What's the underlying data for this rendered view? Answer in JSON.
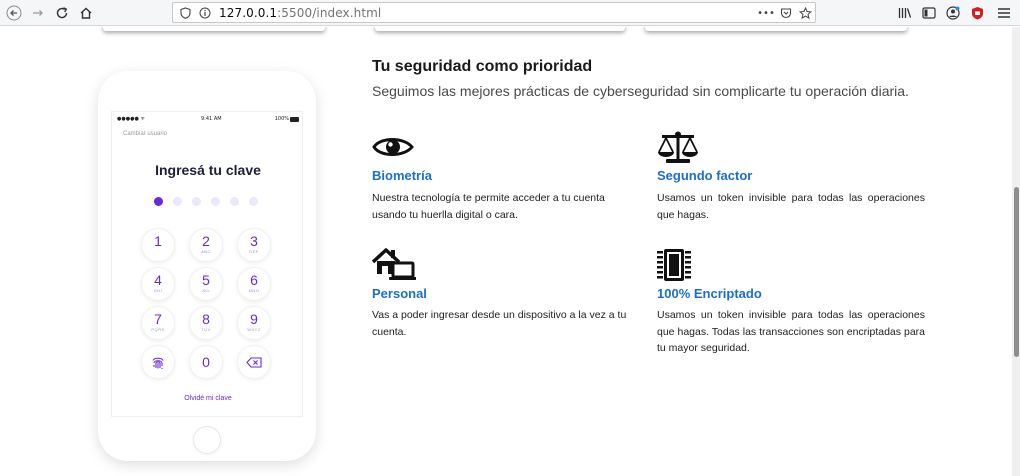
{
  "browser": {
    "url_host": "127.0.0.1",
    "url_rest": ":5500/index.html",
    "icons": {
      "back": "back-arrow-icon",
      "forward": "forward-arrow-icon",
      "reload": "reload-icon",
      "home": "home-icon",
      "shield": "tracking-shield-icon",
      "info": "site-info-icon",
      "menu_dots": "page-actions-icon",
      "pocket": "pocket-icon",
      "bookmark": "bookmark-star-icon",
      "library": "library-icon",
      "sidebar": "sidebar-icon",
      "account": "account-icon",
      "ublock": "ublock-icon"
    },
    "ellipsis": "•••"
  },
  "phone": {
    "status_left": "●●●●● ᯤ",
    "status_time": "9:41 AM",
    "status_battery": "100%",
    "change_user": "Cambiar usuario",
    "title": "Ingresá tu clave",
    "pin_length": 6,
    "pin_filled": 1,
    "keys": [
      {
        "num": "1",
        "letters": ""
      },
      {
        "num": "2",
        "letters": "ABC"
      },
      {
        "num": "3",
        "letters": "DEF"
      },
      {
        "num": "4",
        "letters": "GHI"
      },
      {
        "num": "5",
        "letters": "JKL"
      },
      {
        "num": "6",
        "letters": "MNO"
      },
      {
        "num": "7",
        "letters": "PQRS"
      },
      {
        "num": "8",
        "letters": "TUV"
      },
      {
        "num": "9",
        "letters": "WXYZ"
      }
    ],
    "zero": "0",
    "fingerprint_icon": "fingerprint-icon",
    "delete_icon": "backspace-icon",
    "forgot": "Olvidé mi clave",
    "accent": "#6a28d9"
  },
  "section": {
    "title": "Tu seguridad como prioridad",
    "subtitle": "Seguimos las mejores prácticas de cyberseguridad sin complicarte tu operación diaria."
  },
  "features": [
    {
      "icon": "eye-icon",
      "title": "Biometría",
      "desc": "Nuestra tecnología te permite acceder a tu cuenta usando tu huerlla digital o cara."
    },
    {
      "icon": "scale-icon",
      "title": "Segundo factor",
      "desc": "Usamos un token invisible para todas las operaciones que hagas."
    },
    {
      "icon": "home-laptop-icon",
      "title": "Personal",
      "desc": "Vas a poder ingresar desde un dispositivo a la vez a tu cuenta."
    },
    {
      "icon": "microchip-icon",
      "title": "100% Encriptado",
      "desc": "Usamos un token invisible para todas las operaciones que hagas. Todas las transacciones son encriptadas para tu mayor seguridad."
    }
  ],
  "colors": {
    "feature_title": "#1a6fcc",
    "accent": "#6a28d9"
  }
}
